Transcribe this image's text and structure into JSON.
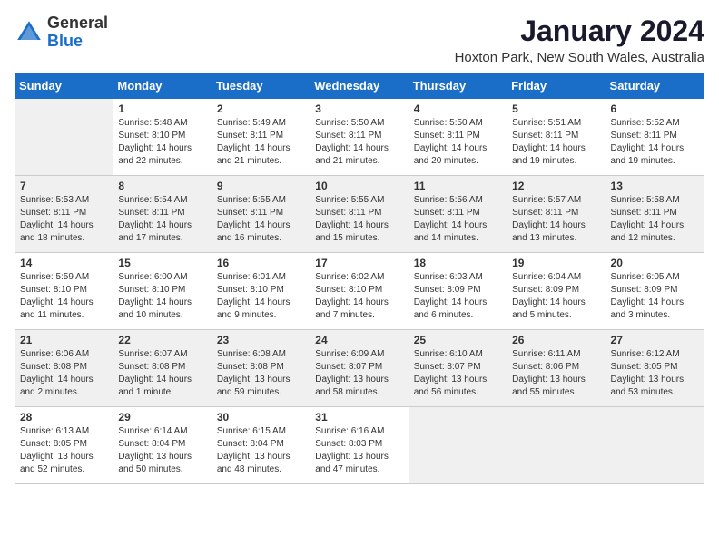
{
  "header": {
    "logo_general": "General",
    "logo_blue": "Blue",
    "month_title": "January 2024",
    "location": "Hoxton Park, New South Wales, Australia"
  },
  "weekdays": [
    "Sunday",
    "Monday",
    "Tuesday",
    "Wednesday",
    "Thursday",
    "Friday",
    "Saturday"
  ],
  "weeks": [
    [
      null,
      {
        "day": 1,
        "sunrise": "5:48 AM",
        "sunset": "8:10 PM",
        "daylight": "14 hours and 22 minutes."
      },
      {
        "day": 2,
        "sunrise": "5:49 AM",
        "sunset": "8:11 PM",
        "daylight": "14 hours and 21 minutes."
      },
      {
        "day": 3,
        "sunrise": "5:50 AM",
        "sunset": "8:11 PM",
        "daylight": "14 hours and 21 minutes."
      },
      {
        "day": 4,
        "sunrise": "5:50 AM",
        "sunset": "8:11 PM",
        "daylight": "14 hours and 20 minutes."
      },
      {
        "day": 5,
        "sunrise": "5:51 AM",
        "sunset": "8:11 PM",
        "daylight": "14 hours and 19 minutes."
      },
      {
        "day": 6,
        "sunrise": "5:52 AM",
        "sunset": "8:11 PM",
        "daylight": "14 hours and 19 minutes."
      }
    ],
    [
      {
        "day": 7,
        "sunrise": "5:53 AM",
        "sunset": "8:11 PM",
        "daylight": "14 hours and 18 minutes."
      },
      {
        "day": 8,
        "sunrise": "5:54 AM",
        "sunset": "8:11 PM",
        "daylight": "14 hours and 17 minutes."
      },
      {
        "day": 9,
        "sunrise": "5:55 AM",
        "sunset": "8:11 PM",
        "daylight": "14 hours and 16 minutes."
      },
      {
        "day": 10,
        "sunrise": "5:55 AM",
        "sunset": "8:11 PM",
        "daylight": "14 hours and 15 minutes."
      },
      {
        "day": 11,
        "sunrise": "5:56 AM",
        "sunset": "8:11 PM",
        "daylight": "14 hours and 14 minutes."
      },
      {
        "day": 12,
        "sunrise": "5:57 AM",
        "sunset": "8:11 PM",
        "daylight": "14 hours and 13 minutes."
      },
      {
        "day": 13,
        "sunrise": "5:58 AM",
        "sunset": "8:11 PM",
        "daylight": "14 hours and 12 minutes."
      }
    ],
    [
      {
        "day": 14,
        "sunrise": "5:59 AM",
        "sunset": "8:10 PM",
        "daylight": "14 hours and 11 minutes."
      },
      {
        "day": 15,
        "sunrise": "6:00 AM",
        "sunset": "8:10 PM",
        "daylight": "14 hours and 10 minutes."
      },
      {
        "day": 16,
        "sunrise": "6:01 AM",
        "sunset": "8:10 PM",
        "daylight": "14 hours and 9 minutes."
      },
      {
        "day": 17,
        "sunrise": "6:02 AM",
        "sunset": "8:10 PM",
        "daylight": "14 hours and 7 minutes."
      },
      {
        "day": 18,
        "sunrise": "6:03 AM",
        "sunset": "8:09 PM",
        "daylight": "14 hours and 6 minutes."
      },
      {
        "day": 19,
        "sunrise": "6:04 AM",
        "sunset": "8:09 PM",
        "daylight": "14 hours and 5 minutes."
      },
      {
        "day": 20,
        "sunrise": "6:05 AM",
        "sunset": "8:09 PM",
        "daylight": "14 hours and 3 minutes."
      }
    ],
    [
      {
        "day": 21,
        "sunrise": "6:06 AM",
        "sunset": "8:08 PM",
        "daylight": "14 hours and 2 minutes."
      },
      {
        "day": 22,
        "sunrise": "6:07 AM",
        "sunset": "8:08 PM",
        "daylight": "14 hours and 1 minute."
      },
      {
        "day": 23,
        "sunrise": "6:08 AM",
        "sunset": "8:08 PM",
        "daylight": "13 hours and 59 minutes."
      },
      {
        "day": 24,
        "sunrise": "6:09 AM",
        "sunset": "8:07 PM",
        "daylight": "13 hours and 58 minutes."
      },
      {
        "day": 25,
        "sunrise": "6:10 AM",
        "sunset": "8:07 PM",
        "daylight": "13 hours and 56 minutes."
      },
      {
        "day": 26,
        "sunrise": "6:11 AM",
        "sunset": "8:06 PM",
        "daylight": "13 hours and 55 minutes."
      },
      {
        "day": 27,
        "sunrise": "6:12 AM",
        "sunset": "8:05 PM",
        "daylight": "13 hours and 53 minutes."
      }
    ],
    [
      {
        "day": 28,
        "sunrise": "6:13 AM",
        "sunset": "8:05 PM",
        "daylight": "13 hours and 52 minutes."
      },
      {
        "day": 29,
        "sunrise": "6:14 AM",
        "sunset": "8:04 PM",
        "daylight": "13 hours and 50 minutes."
      },
      {
        "day": 30,
        "sunrise": "6:15 AM",
        "sunset": "8:04 PM",
        "daylight": "13 hours and 48 minutes."
      },
      {
        "day": 31,
        "sunrise": "6:16 AM",
        "sunset": "8:03 PM",
        "daylight": "13 hours and 47 minutes."
      },
      null,
      null,
      null
    ]
  ]
}
